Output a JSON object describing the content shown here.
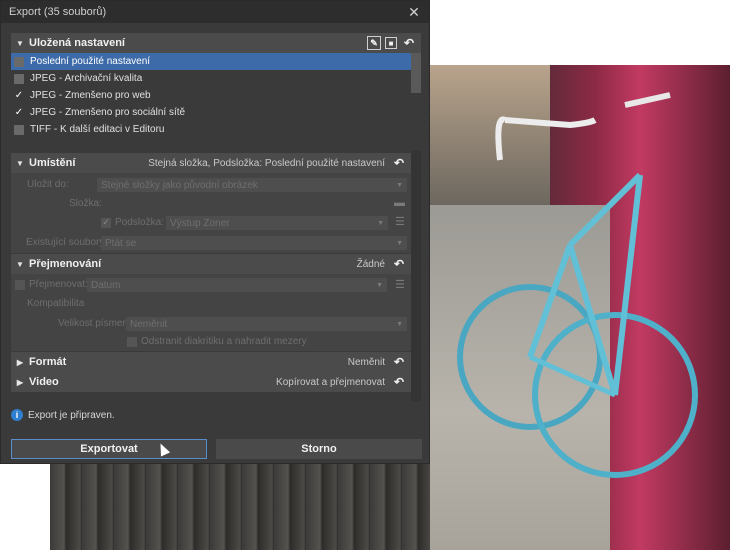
{
  "window": {
    "title": "Export (35 souborů)"
  },
  "sections": {
    "saved": {
      "title": "Uložená nastavení"
    },
    "location": {
      "title": "Umístění",
      "summary": "Stejná složka, Podsložka: Poslední použité nastavení"
    },
    "rename": {
      "title": "Přejmenování",
      "summary": "Žádné"
    },
    "format": {
      "title": "Formát",
      "summary": "Neměnit"
    },
    "video": {
      "title": "Video",
      "summary": "Kopírovat a přejmenovat"
    }
  },
  "presets": [
    {
      "label": "Poslední použité nastavení",
      "checked": false,
      "selected": true
    },
    {
      "label": "JPEG - Archivační kvalita",
      "checked": false,
      "selected": false
    },
    {
      "label": "JPEG - Zmenšeno pro web",
      "checked": true,
      "selected": false
    },
    {
      "label": "JPEG - Zmenšeno pro sociální sítě",
      "checked": true,
      "selected": false
    },
    {
      "label": "TIFF - K další editaci v Editoru",
      "checked": false,
      "selected": false
    }
  ],
  "location_fields": {
    "save_to_label": "Uložit do:",
    "save_to_value": "Stejné složky jako původní obrázek",
    "folder_label": "Složka:",
    "subfolder_label": "Podsložka:",
    "subfolder_value": "Výstup Zoner",
    "existing_label": "Existující soubory:",
    "existing_value": "Ptát se"
  },
  "rename_fields": {
    "rename_label": "Přejmenovat:",
    "rename_value": "Datum",
    "compat_label": "Kompatibilita",
    "case_label": "Velikost písmen:",
    "case_value": "Neměnit",
    "diacritics_label": "Odstranit diakritiku a nahradit mezery"
  },
  "status": {
    "text": "Export je připraven."
  },
  "buttons": {
    "export": "Exportovat",
    "cancel": "Storno"
  },
  "icons": [
    "close-icon",
    "caret-down-icon",
    "caret-right-icon",
    "undo-icon",
    "preset-edit-icon",
    "save-icon",
    "folder-icon",
    "menu-icon",
    "info-icon"
  ],
  "colors": {
    "selected_row": "#3d6aa8",
    "info": "#2f7fd1",
    "dialog_bg": "#3a3a3a",
    "primary_border": "#5a8ec9"
  }
}
